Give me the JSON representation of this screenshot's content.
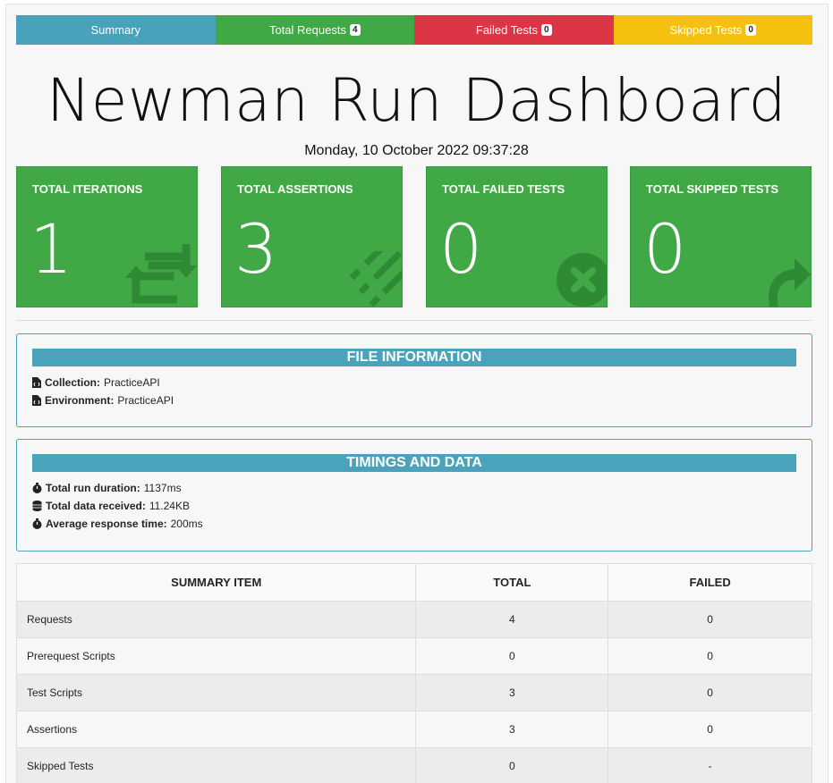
{
  "nav": {
    "summary": {
      "label": "Summary",
      "color": "#48a2ba"
    },
    "requests": {
      "label": "Total Requests",
      "count": "4",
      "color": "#41a846"
    },
    "failed": {
      "label": "Failed Tests",
      "count": "0",
      "color": "#dc3545"
    },
    "skipped": {
      "label": "Skipped Tests",
      "count": "0",
      "color": "#f5c010"
    }
  },
  "header": {
    "title": "Newman Run Dashboard",
    "date": "Monday, 10 October 2022 09:37:28"
  },
  "cards": [
    {
      "label": "TOTAL ITERATIONS",
      "value": "1",
      "icon": "retweet-icon"
    },
    {
      "label": "TOTAL ASSERTIONS",
      "value": "3",
      "icon": "tasks-icon"
    },
    {
      "label": "TOTAL FAILED TESTS",
      "value": "0",
      "icon": "times-circle-icon"
    },
    {
      "label": "TOTAL SKIPPED TESTS",
      "value": "0",
      "icon": "share-icon"
    }
  ],
  "file_info": {
    "heading": "FILE INFORMATION",
    "collection_label": "Collection:",
    "collection_value": "PracticeAPI",
    "environment_label": "Environment:",
    "environment_value": "PracticeAPI"
  },
  "timings": {
    "heading": "TIMINGS AND DATA",
    "duration_label": "Total run duration:",
    "duration_value": "1137ms",
    "data_label": "Total data received:",
    "data_value": "11.24KB",
    "avg_label": "Average response time:",
    "avg_value": "200ms"
  },
  "summary_table": {
    "headers": [
      "SUMMARY ITEM",
      "TOTAL",
      "FAILED"
    ],
    "rows": [
      [
        "Requests",
        "4",
        "0"
      ],
      [
        "Prerequest Scripts",
        "0",
        "0"
      ],
      [
        "Test Scripts",
        "3",
        "0"
      ],
      [
        "Assertions",
        "3",
        "0"
      ],
      [
        "Skipped Tests",
        "0",
        "-"
      ]
    ]
  }
}
